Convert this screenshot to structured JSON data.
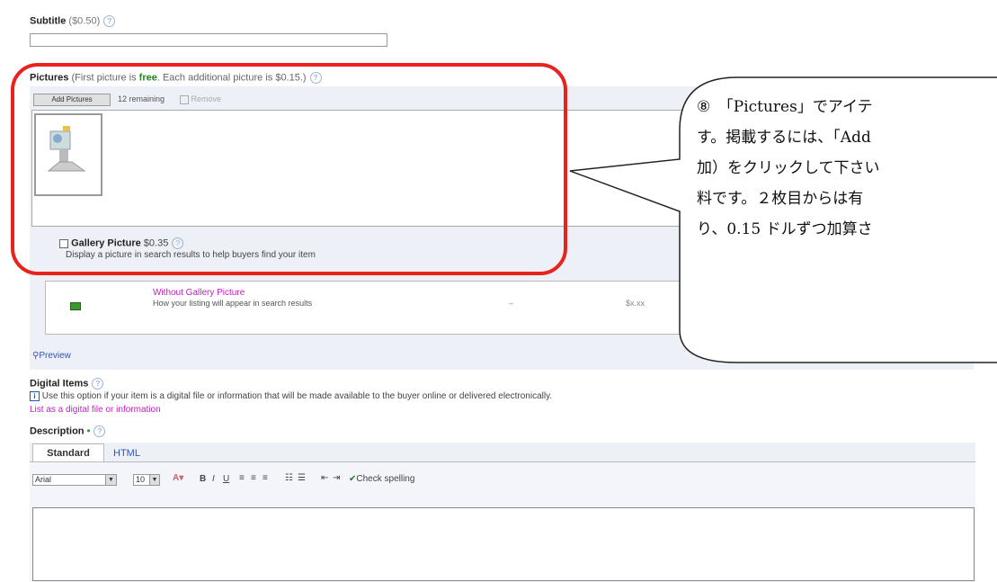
{
  "subtitle": {
    "label": "Subtitle",
    "price": "($0.50)"
  },
  "pictures": {
    "label": "Pictures",
    "note_before": "(First picture is ",
    "note_free": "free",
    "note_after": ". Each additional picture is $0.15.)",
    "add_button": "Add Pictures",
    "remaining": "12 remaining",
    "remove": "Remove"
  },
  "gallery": {
    "label": "Gallery Picture",
    "price": "$0.35",
    "description": "Display a picture in search results to help buyers find your item",
    "option_title": "Without Gallery Picture",
    "option_desc": "How your listing will appear in search results",
    "option_dash": "–",
    "option_price": "$x.xx"
  },
  "preview": "Preview",
  "digital": {
    "label": "Digital Items",
    "info": "Use this option if your item is a digital file or information that will be made available to the buyer online or delivered electronically.",
    "link": "List as a digital file or information"
  },
  "description": {
    "label": "Description",
    "tabs": [
      "Standard",
      "HTML"
    ],
    "font": "Arial",
    "size": "10",
    "spell": "Check spelling"
  },
  "callout": {
    "number": "⑧",
    "line1": "「Pictures」でアイテ",
    "line2": "す。掲載するには、「Add",
    "line3": "加）をクリックして下さい",
    "line4": "料です。２枚目からは有",
    "line5": "り、0.15 ドルずつ加算さ"
  },
  "colors": {
    "highlight": "#e8231e",
    "free": "#228822",
    "link": "#c020c0"
  }
}
